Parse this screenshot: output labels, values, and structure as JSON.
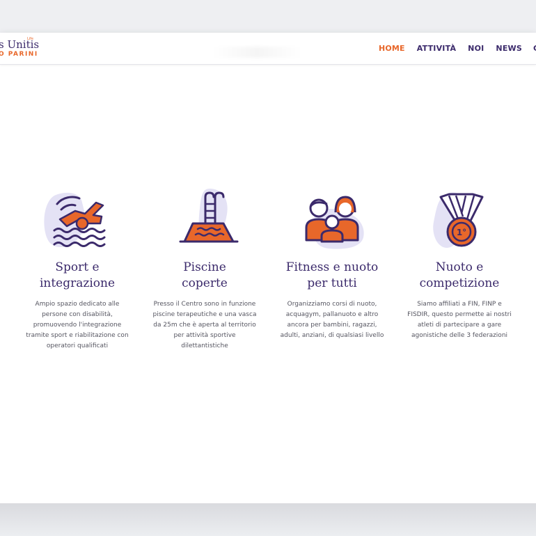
{
  "logo": {
    "top": "s Unitis",
    "bottom": "O PARINI",
    "mini": "Life"
  },
  "nav": {
    "items": [
      {
        "label": "HOME",
        "active": true
      },
      {
        "label": "ATTIVITÀ",
        "active": false
      },
      {
        "label": "NOI",
        "active": false
      },
      {
        "label": "NEWS",
        "active": false
      },
      {
        "label": "C",
        "active": false
      }
    ]
  },
  "features": [
    {
      "icon": "swimmer-icon",
      "title_line1": "Sport e",
      "title_line2": "integrazione",
      "text": "Ampio spazio dedicato alle persone con disabilità, promuovendo l'integrazione tramite sport e riabilitazione con operatori qualificati"
    },
    {
      "icon": "pool-icon",
      "title_line1": "Piscine",
      "title_line2": "coperte",
      "text": "Presso il Centro sono in funzione piscine terapeutiche e una vasca da 25m che è aperta al territorio per attività sportive dilettantistiche"
    },
    {
      "icon": "family-icon",
      "title_line1": "Fitness e nuoto",
      "title_line2": "per tutti",
      "text": "Organizziamo corsi di nuoto, acquagym, pallanuoto e altro ancora per bambini, ragazzi, adulti, anziani, di qualsiasi livello"
    },
    {
      "icon": "medal-icon",
      "title_line1": "Nuoto e",
      "title_line2": "competizione",
      "text": "Siamo affiliati a FIN, FINP e FISDIR, questo permette ai nostri atleti di partecipare a gare agonistiche delle 3 federazioni",
      "medal_label": "1°"
    }
  ],
  "colors": {
    "primary": "#3b2a6b",
    "accent": "#e8672a",
    "blob": "#e4e2f5"
  }
}
